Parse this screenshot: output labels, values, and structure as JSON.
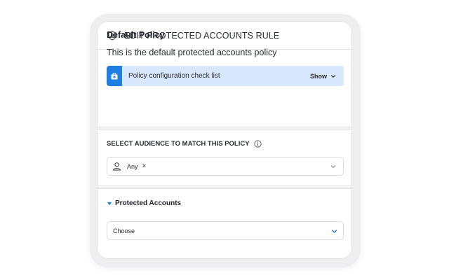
{
  "header": {
    "title": "EDIT PROTECTED ACCOUNTS RULE",
    "icon": "shield-user-icon"
  },
  "policy": {
    "name": "Default Policy",
    "description": "This is the default protected accounts policy"
  },
  "checklist": {
    "label": "Policy configuration check list",
    "toggle_label": "Show",
    "icon": "first-aid-kit-icon",
    "accent_color": "#1d7fe0",
    "background_color": "#d8e7fb"
  },
  "audience": {
    "label": "SELECT AUDIENCE TO MATCH THIS POLICY",
    "info_icon": "info-icon",
    "selected_chip": "Any",
    "remove_symbol": "×"
  },
  "protected_accounts": {
    "title": "Protected Accounts",
    "caret_color": "#1d7fe0",
    "select_value": "Choose"
  }
}
